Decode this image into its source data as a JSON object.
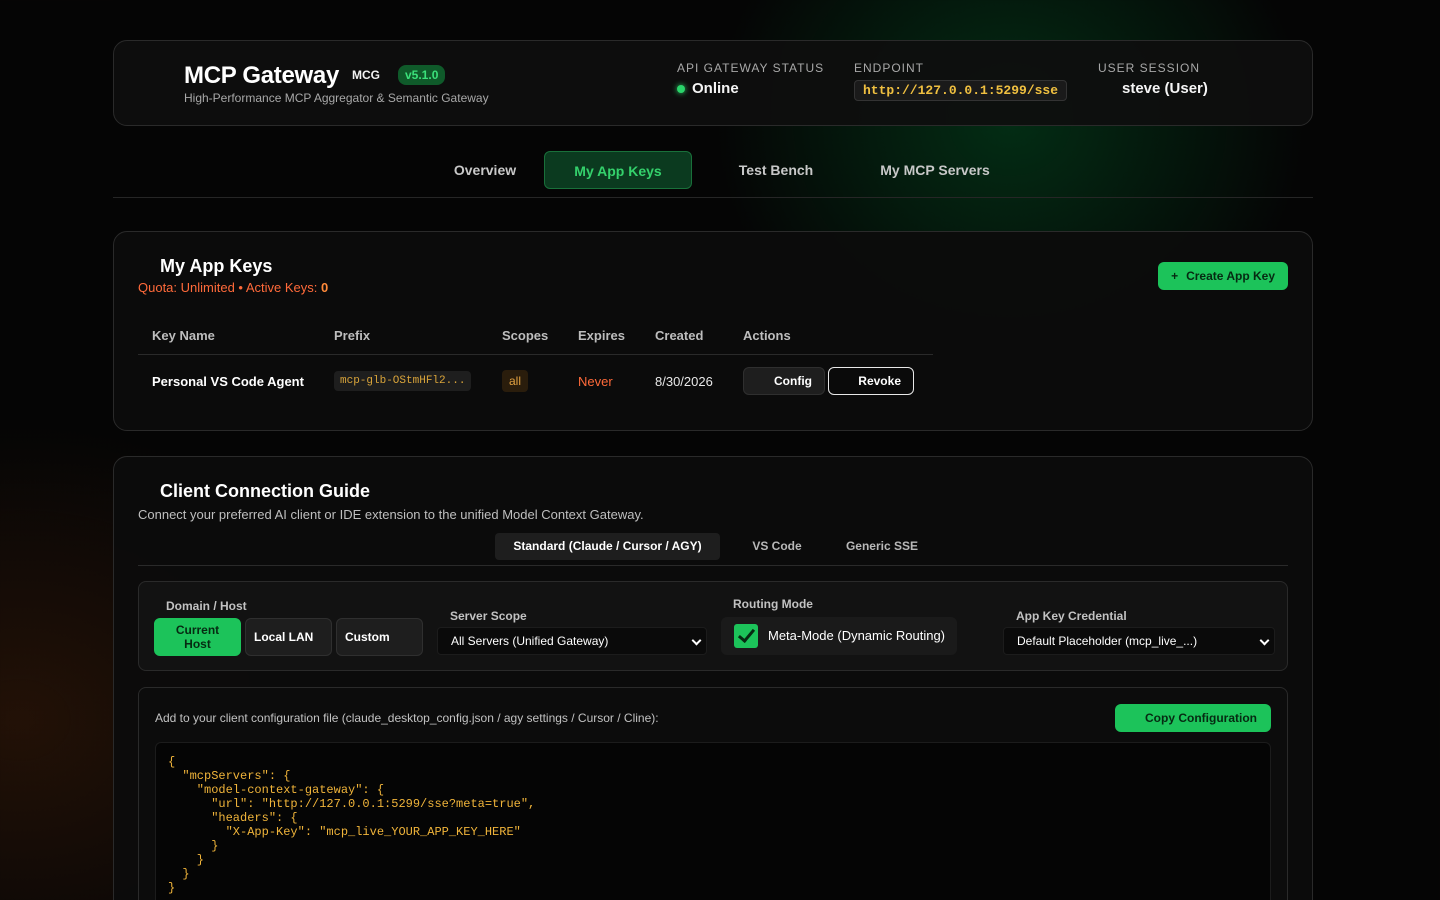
{
  "header": {
    "title": "MCP Gateway",
    "tag": "MCG",
    "version": "v5.1.0",
    "subtitle": "High-Performance MCP Aggregator & Semantic Gateway",
    "status_label": "API GATEWAY STATUS",
    "status_value": "Online",
    "endpoint_label": "ENDPOINT",
    "endpoint_value": "http://127.0.0.1:5299/sse",
    "session_label": "USER SESSION",
    "session_value": "steve (User)"
  },
  "nav": {
    "tabs": [
      {
        "label": "Overview",
        "active": false
      },
      {
        "label": "My App Keys",
        "active": true
      },
      {
        "label": "Test Bench",
        "active": false
      },
      {
        "label": "My MCP Servers",
        "active": false
      }
    ]
  },
  "app_keys": {
    "title": "My App Keys",
    "quota_text": "Quota: Unlimited • Active Keys: ",
    "active_keys": "0",
    "create_button": "Create App Key",
    "create_icon": "+",
    "columns": [
      "Key Name",
      "Prefix",
      "Scopes",
      "Expires",
      "Created",
      "Actions"
    ],
    "rows": [
      {
        "name": "Personal VS Code Agent",
        "prefix": "mcp-glb-OStmHFl2...",
        "scope": "all",
        "expires": "Never",
        "created": "8/30/2026",
        "config_label": "Config",
        "revoke_label": "Revoke"
      }
    ]
  },
  "guide": {
    "title": "Client Connection Guide",
    "description": "Connect your preferred AI client or IDE extension to the unified Model Context Gateway.",
    "tabs": [
      {
        "label": "Standard (Claude / Cursor / AGY)",
        "active": true
      },
      {
        "label": "VS Code",
        "active": false
      },
      {
        "label": "Generic SSE",
        "active": false
      }
    ],
    "domain_label": "Domain / Host",
    "host_options": [
      "Current Host",
      "Local LAN",
      "Custom"
    ],
    "host_selected": "Current Host",
    "scope_label": "Server Scope",
    "scope_value": "All Servers (Unified Gateway)",
    "routing_label": "Routing Mode",
    "routing_value": "Meta-Mode (Dynamic Routing)",
    "routing_checked": true,
    "credential_label": "App Key Credential",
    "credential_value": "Default Placeholder (mcp_live_...)",
    "config_hint": "Add to your client configuration file (claude_desktop_config.json / agy settings / Cursor / Cline):",
    "copy_button": "Copy Configuration",
    "code": "{\n  \"mcpServers\": {\n    \"model-context-gateway\": {\n      \"url\": \"http://127.0.0.1:5299/sse?meta=true\",\n      \"headers\": {\n        \"X-App-Key\": \"mcp_live_YOUR_APP_KEY_HERE\"\n      }\n    }\n  }\n}"
  },
  "colors": {
    "accent": "#1cc35a",
    "warning": "#ff6a3a",
    "code": "#f0b43a"
  }
}
